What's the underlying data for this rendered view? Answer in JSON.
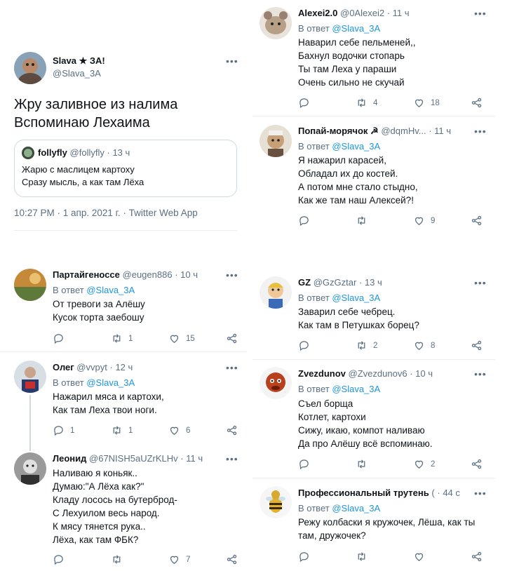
{
  "main_tweet": {
    "name": "Slava ★ ЗА!",
    "handle": "@Slava_3A",
    "text_lines": [
      "Жру заливное из налима",
      "Вспоминаю Лехаима"
    ],
    "quote": {
      "name": "follyfly",
      "handle": "@follyfly",
      "time": "13 ч",
      "text_lines": [
        "Жарю с маслицем картоху",
        "Сразу мысль, а как там Лёха"
      ]
    },
    "meta": "10:27 PM · 1 апр. 2021 г. · Twitter Web App"
  },
  "reply_prefix": "В ответ",
  "reply_mention": "@Slava_3A",
  "separator_dot": "·",
  "left_replies": [
    {
      "name": "Партайгеноссе",
      "handle": "@eugen886",
      "time": "10 ч",
      "text_lines": [
        "От тревоги за Алёшу",
        "Кусок торта заебошу"
      ],
      "counts": {
        "reply": "",
        "retweet": "1",
        "like": "15"
      }
    },
    {
      "name": "Олег",
      "handle": "@vvpyt",
      "time": "12 ч",
      "text_lines": [
        "Нажарил мяса и картохи,",
        "Как там Леха твои ноги."
      ],
      "counts": {
        "reply": "1",
        "retweet": "1",
        "like": "6"
      }
    },
    {
      "name": "Леонид",
      "handle": "@67NISH5aUZrKLHv",
      "time": "11 ч",
      "text_lines": [
        "Наливаю я коньяк..",
        "Думаю:\"А Лёха как?\"",
        "Кладу лосось на бутерброд-",
        "С Лехуилом весь народ.",
        "К мясу тянется рука..",
        "Лёха, как там ФБК?"
      ],
      "counts": {
        "reply": "",
        "retweet": "",
        "like": "7"
      }
    }
  ],
  "right_replies": [
    {
      "name": "Alexei2.0",
      "handle": "@0Alexei2",
      "time": "11 ч",
      "text_lines": [
        "Наварил себе пельменей,,",
        "Бахнул водочки стопарь",
        "Ты там Леха у параши",
        "Очень сильно не скучай"
      ],
      "counts": {
        "reply": "",
        "retweet": "4",
        "like": "18"
      }
    },
    {
      "name": "Попай-морячок ☭",
      "handle": "@dqmHv...",
      "time": "11 ч",
      "text_lines": [
        "Я нажарил карасей,",
        "Обладал их до костей.",
        "А потом мне стало стыдно,",
        "Как же там наш Алексей?!"
      ],
      "counts": {
        "reply": "",
        "retweet": "",
        "like": "9"
      }
    },
    {
      "name": "GZ",
      "handle": "@GzGztar",
      "time": "13 ч",
      "text_lines": [
        "Заварил себе чебрец.",
        "Как там в Петушках борец?"
      ],
      "counts": {
        "reply": "",
        "retweet": "2",
        "like": "8"
      }
    },
    {
      "name": "Zvezdunov",
      "handle": "@Zvezdunov6",
      "time": "10 ч",
      "text_lines": [
        "Съел борща",
        "Котлет, картохи",
        "Сижу, икаю, компот наливаю",
        "Да про Алёшу всё вспоминаю."
      ],
      "counts": {
        "reply": "",
        "retweet": "",
        "like": "2"
      }
    },
    {
      "name": "Профессиональный трутень",
      "handle": "(",
      "time": "44 с",
      "text_lines": [
        "Режу колбаски я кружочек, Лёша, как ты",
        "там, дружочек?"
      ],
      "counts": {
        "reply": "",
        "retweet": "",
        "like": ""
      }
    }
  ],
  "icons": [
    "reply-icon",
    "retweet-icon",
    "like-icon",
    "share-icon",
    "more-icon"
  ],
  "colors": {
    "text": "#0f1419",
    "secondary": "#5b7083",
    "link": "#1b95e0",
    "border": "#ebeef0"
  }
}
